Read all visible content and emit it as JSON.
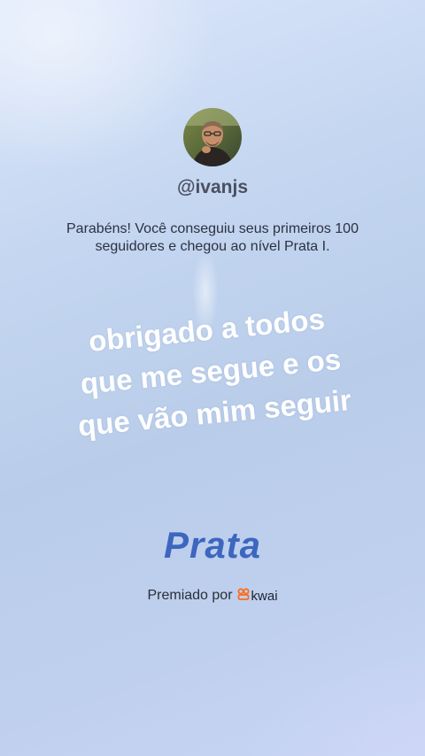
{
  "profile": {
    "username": "@ivanjs",
    "avatar_icon": "profile-photo"
  },
  "message": "Parabéns! Você conseguiu seus primeiros 100 seguidores e chegou ao nível Prata I.",
  "overlay": {
    "lines": [
      "obrigado a todos",
      "que me segue e os",
      "que vão mim seguir"
    ]
  },
  "level": {
    "name": "Prata",
    "color": "#3d66bf"
  },
  "footer": {
    "awarded_by": "Premiado por",
    "brand": "kwai",
    "brand_icon": "kwai-logo-icon",
    "brand_color": "#ff6a1a"
  }
}
